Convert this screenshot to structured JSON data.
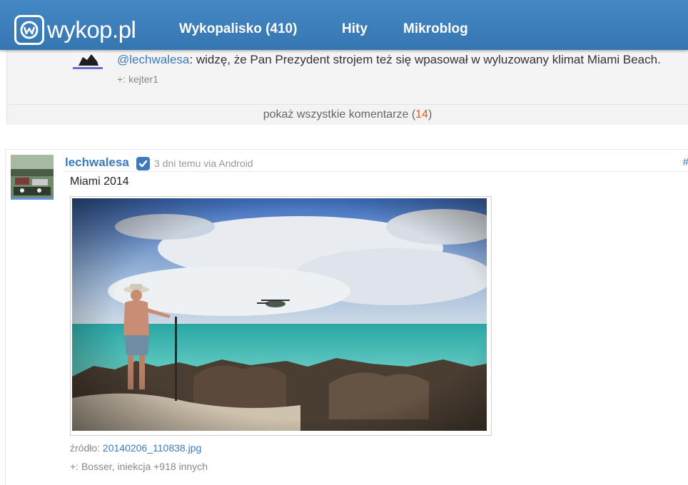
{
  "header": {
    "logo_text": "wykop.pl",
    "nav": [
      {
        "label": "Wykopalisko (410)"
      },
      {
        "label": "Hity"
      },
      {
        "label": "Mikroblog"
      }
    ],
    "brand_color": "#3a7db8"
  },
  "comment": {
    "mention": "@lechwalesa",
    "text": ": widzę, że Pan Prezydent strojem też się wpasował w wyluzowany klimat Miami Beach.",
    "plus_line": "+: kejter1"
  },
  "show_all": {
    "label": "pokaż wszystkie komentarze (",
    "count": "14",
    "close": ")"
  },
  "post": {
    "author": "lechwalesa",
    "meta": "3 dni temu via Android",
    "hash": "#",
    "text": "Miami 2014",
    "source_label": "źródło: ",
    "source_file": "20140206_110838.jpg",
    "plus_line": "+: Bosser, iniekcja +918 innych"
  },
  "icons": {
    "verified": "check-badge-icon",
    "logo": "wykop-logo-icon"
  }
}
